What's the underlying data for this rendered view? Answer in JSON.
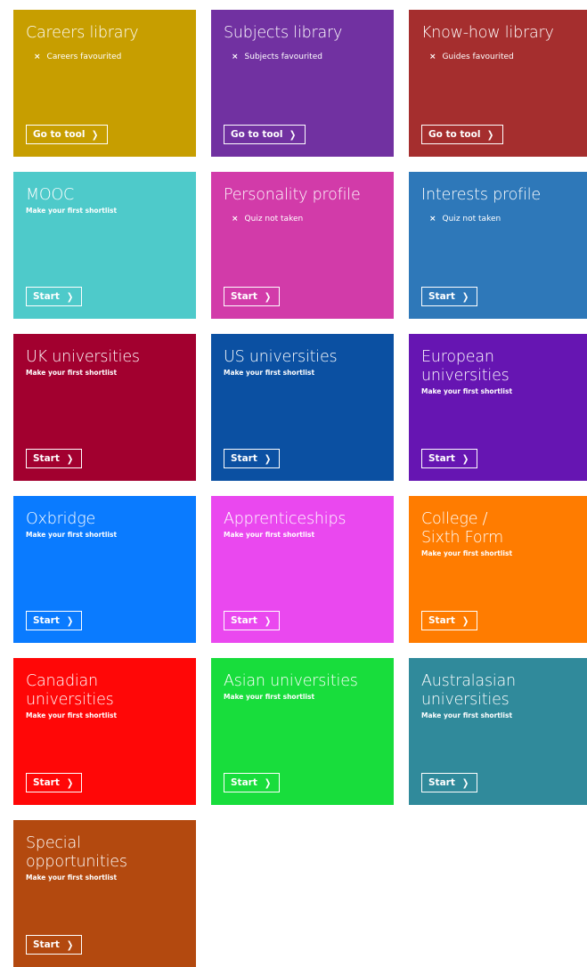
{
  "tiles": [
    {
      "title": "Careers library",
      "status": "Careers favourited",
      "subtitle": null,
      "button": "Go to tool",
      "color": "#C79E00"
    },
    {
      "title": "Subjects library",
      "status": "Subjects favourited",
      "subtitle": null,
      "button": "Go to tool",
      "color": "#7131A1"
    },
    {
      "title": "Know-how library",
      "status": "Guides favourited",
      "subtitle": null,
      "button": "Go to tool",
      "color": "#A52E2E"
    },
    {
      "title": "MOOC",
      "status": null,
      "subtitle": "Make your first shortlist",
      "button": "Start",
      "color": "#4ECACA"
    },
    {
      "title": "Personality profile",
      "status": "Quiz not taken",
      "subtitle": null,
      "button": "Start",
      "color": "#D23BA9"
    },
    {
      "title": "Interests profile",
      "status": "Quiz not taken",
      "subtitle": null,
      "button": "Start",
      "color": "#2E78B9"
    },
    {
      "title": "UK universities",
      "status": null,
      "subtitle": "Make your first shortlist",
      "button": "Start",
      "color": "#A2002F"
    },
    {
      "title": "US universities",
      "status": null,
      "subtitle": "Make your first shortlist",
      "button": "Start",
      "color": "#0B50A2"
    },
    {
      "title": "European\nuniversities",
      "status": null,
      "subtitle": "Make your first shortlist",
      "button": "Start",
      "color": "#6615B2"
    },
    {
      "title": "Oxbridge",
      "status": null,
      "subtitle": "Make your first shortlist",
      "button": "Start",
      "color": "#0A7BFF"
    },
    {
      "title": "Apprenticeships",
      "status": null,
      "subtitle": "Make your first shortlist",
      "button": "Start",
      "color": "#EA48EF"
    },
    {
      "title": "College /\nSixth Form",
      "status": null,
      "subtitle": "Make your first shortlist",
      "button": "Start",
      "color": "#FF7C00"
    },
    {
      "title": "Canadian\nuniversities",
      "status": null,
      "subtitle": "Make your first shortlist",
      "button": "Start",
      "color": "#FF0707"
    },
    {
      "title": "Asian universities",
      "status": null,
      "subtitle": "Make your first shortlist",
      "button": "Start",
      "color": "#18DD3C"
    },
    {
      "title": "Australasian\nuniversities",
      "status": null,
      "subtitle": "Make your first shortlist",
      "button": "Start",
      "color": "#308A9B"
    },
    {
      "title": "Special\nopportunities",
      "status": null,
      "subtitle": "Make your first shortlist",
      "button": "Start",
      "color": "#B3490F"
    }
  ],
  "icons": {
    "status": "×",
    "chevron": "❯"
  }
}
